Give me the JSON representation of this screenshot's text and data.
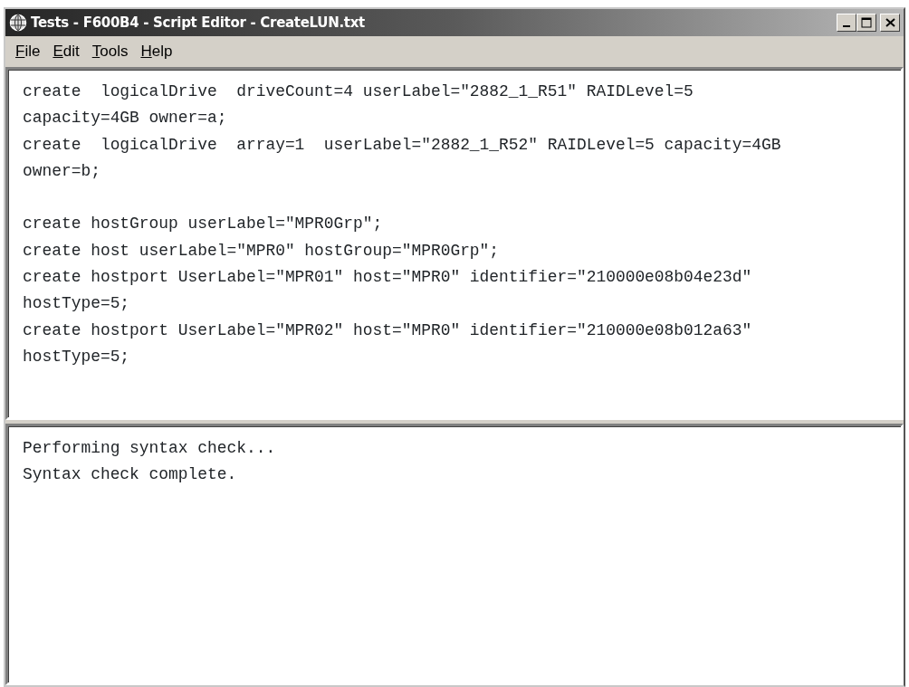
{
  "window": {
    "title": "Tests - F600B4 - Script Editor - CreateLUN.txt"
  },
  "menu": [
    "File",
    "Edit",
    "Tools",
    "Help"
  ],
  "editor": {
    "paragraphs": [
      [
        "create  logicalDrive  driveCount=4 userLabel=\"2882_1_R51\" RAIDLevel=5",
        "capacity=4GB owner=a;",
        "create  logicalDrive  array=1  userLabel=\"2882_1_R52\" RAIDLevel=5 capacity=4GB",
        "owner=b;"
      ],
      [
        "create hostGroup userLabel=\"MPR0Grp\";",
        "create host userLabel=\"MPR0\" hostGroup=\"MPR0Grp\";",
        "create hostport UserLabel=\"MPR01\" host=\"MPR0\" identifier=\"210000e08b04e23d\"",
        "hostType=5;",
        "create hostport UserLabel=\"MPR02\" host=\"MPR0\" identifier=\"210000e08b012a63\"",
        "hostType=5;"
      ]
    ]
  },
  "output": {
    "lines": [
      "Performing syntax check...",
      "Syntax check complete."
    ]
  }
}
